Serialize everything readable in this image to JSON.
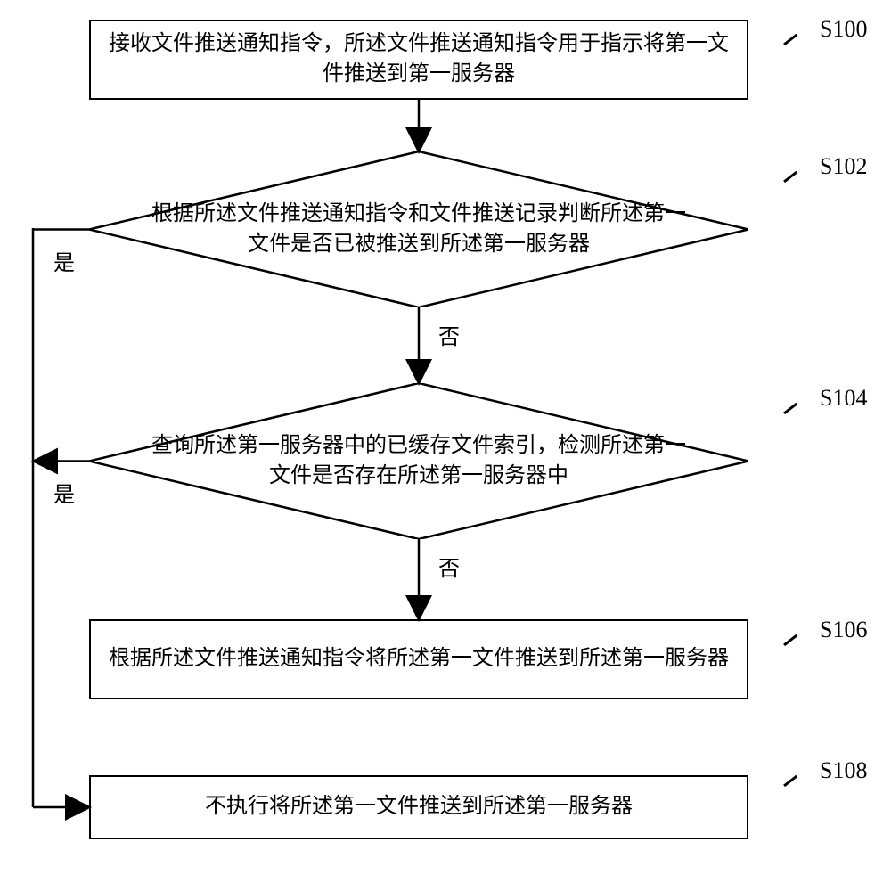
{
  "chart_data": {
    "type": "flowchart",
    "nodes": [
      {
        "id": "S100",
        "kind": "process",
        "text": "接收文件推送通知指令，所述文件推送通知指令用于指示将第一文件推送到第一服务器"
      },
      {
        "id": "S102",
        "kind": "decision",
        "text": "根据所述文件推送通知指令和文件推送记录判断所述第一文件是否已被推送到所述第一服务器"
      },
      {
        "id": "S104",
        "kind": "decision",
        "text": "查询所述第一服务器中的已缓存文件索引，检测所述第一文件是否存在所述第一服务器中"
      },
      {
        "id": "S106",
        "kind": "process",
        "text": "根据所述文件推送通知指令将所述第一文件推送到所述第一服务器"
      },
      {
        "id": "S108",
        "kind": "process",
        "text": "不执行将所述第一文件推送到所述第一服务器"
      }
    ],
    "edges": [
      {
        "from": "S100",
        "to": "S102"
      },
      {
        "from": "S102",
        "to": "S104",
        "label": "否"
      },
      {
        "from": "S102",
        "to": "S108",
        "label": "是"
      },
      {
        "from": "S104",
        "to": "S106",
        "label": "否"
      },
      {
        "from": "S104",
        "to": "S108",
        "label": "是"
      }
    ]
  },
  "labels": {
    "s100": "S100",
    "s102": "S102",
    "s104": "S104",
    "s106": "S106",
    "s108": "S108",
    "yes": "是",
    "no": "否"
  },
  "texts": {
    "n100": "接收文件推送通知指令，所述文件推送通知指令用于指示将第一文件推送到第一服务器",
    "n102": "根据所述文件推送通知指令和文件推送记录判断所述第一文件是否已被推送到所述第一服务器",
    "n104": "查询所述第一服务器中的已缓存文件索引，检测所述第一文件是否存在所述第一服务器中",
    "n106": "根据所述文件推送通知指令将所述第一文件推送到所述第一服务器",
    "n108": "不执行将所述第一文件推送到所述第一服务器"
  }
}
